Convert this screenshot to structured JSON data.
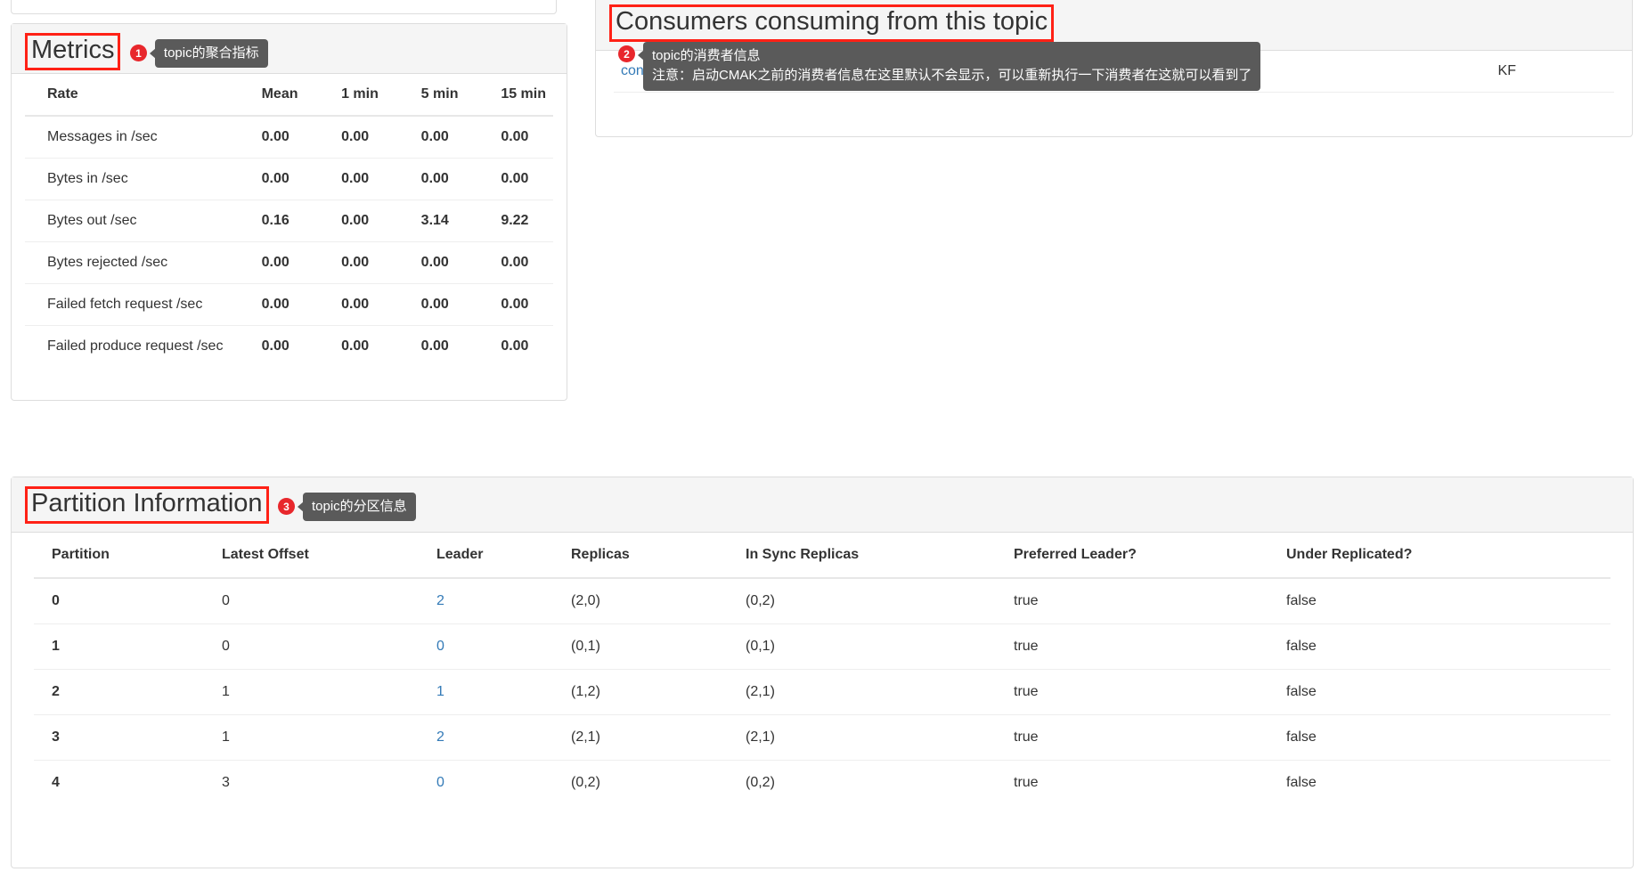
{
  "metrics_panel": {
    "title": "Metrics",
    "annotation": {
      "number": "1",
      "tooltip": "topic的聚合指标"
    },
    "table": {
      "headers": [
        "Rate",
        "Mean",
        "1 min",
        "5 min",
        "15 min"
      ],
      "rows": [
        {
          "rate": "Messages in /sec",
          "mean": "0.00",
          "m1": "0.00",
          "m5": "0.00",
          "m15": "0.00"
        },
        {
          "rate": "Bytes in /sec",
          "mean": "0.00",
          "m1": "0.00",
          "m5": "0.00",
          "m15": "0.00"
        },
        {
          "rate": "Bytes out /sec",
          "mean": "0.16",
          "m1": "0.00",
          "m5": "3.14",
          "m15": "9.22"
        },
        {
          "rate": "Bytes rejected /sec",
          "mean": "0.00",
          "m1": "0.00",
          "m5": "0.00",
          "m15": "0.00"
        },
        {
          "rate": "Failed fetch request /sec",
          "mean": "0.00",
          "m1": "0.00",
          "m5": "0.00",
          "m15": "0.00"
        },
        {
          "rate": "Failed produce request /sec",
          "mean": "0.00",
          "m1": "0.00",
          "m5": "0.00",
          "m15": "0.00"
        }
      ]
    }
  },
  "consumers_panel": {
    "title": "Consumers consuming from this topic",
    "annotation": {
      "number": "2",
      "tooltip_line1": "topic的消费者信息",
      "tooltip_line2": "注意：启动CMAK之前的消费者信息在这里默认不会显示，可以重新执行一下消费者在这就可以看到了"
    },
    "rows": [
      {
        "consumer": "con-2",
        "type": "KF"
      }
    ]
  },
  "partition_panel": {
    "title": "Partition Information",
    "annotation": {
      "number": "3",
      "tooltip": "topic的分区信息"
    },
    "table": {
      "headers": [
        "Partition",
        "Latest Offset",
        "Leader",
        "Replicas",
        "In Sync Replicas",
        "Preferred Leader?",
        "Under Replicated?"
      ],
      "rows": [
        {
          "partition": "0",
          "latest_offset": "0",
          "leader": "2",
          "replicas": "(2,0)",
          "isr": "(0,2)",
          "preferred_leader": "true",
          "under_replicated": "false"
        },
        {
          "partition": "1",
          "latest_offset": "0",
          "leader": "0",
          "replicas": "(0,1)",
          "isr": "(0,1)",
          "preferred_leader": "true",
          "under_replicated": "false"
        },
        {
          "partition": "2",
          "latest_offset": "1",
          "leader": "1",
          "replicas": "(1,2)",
          "isr": "(2,1)",
          "preferred_leader": "true",
          "under_replicated": "false"
        },
        {
          "partition": "3",
          "latest_offset": "1",
          "leader": "2",
          "replicas": "(2,1)",
          "isr": "(2,1)",
          "preferred_leader": "true",
          "under_replicated": "false"
        },
        {
          "partition": "4",
          "latest_offset": "3",
          "leader": "0",
          "replicas": "(0,2)",
          "isr": "(0,2)",
          "preferred_leader": "true",
          "under_replicated": "false"
        }
      ]
    }
  },
  "colors": {
    "annotation_red": "#ff2116",
    "badge_red": "#e8272c",
    "tooltip_gray": "#5a5a5a",
    "link_blue": "#337ab7",
    "panel_header_bg": "#f5f5f5"
  }
}
